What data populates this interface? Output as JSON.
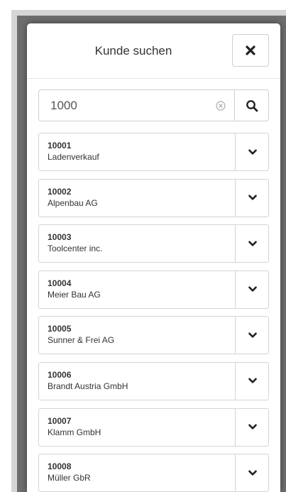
{
  "dialog": {
    "title": "Kunde suchen",
    "close_icon": "close-x-icon"
  },
  "search": {
    "value": "1000",
    "clear_icon": "clear-circle-icon",
    "search_icon": "search-icon"
  },
  "customers": [
    {
      "id": "10001",
      "name": "Ladenverkauf"
    },
    {
      "id": "10002",
      "name": "Alpenbau AG"
    },
    {
      "id": "10003",
      "name": "Toolcenter inc."
    },
    {
      "id": "10004",
      "name": "Meier Bau AG"
    },
    {
      "id": "10005",
      "name": "Sunner & Frei AG"
    },
    {
      "id": "10006",
      "name": "Brandt Austria GmbH"
    },
    {
      "id": "10007",
      "name": "Klamm GmbH"
    },
    {
      "id": "10008",
      "name": "Müller GbR"
    }
  ],
  "item_toggle_icon": "chevron-down-icon"
}
